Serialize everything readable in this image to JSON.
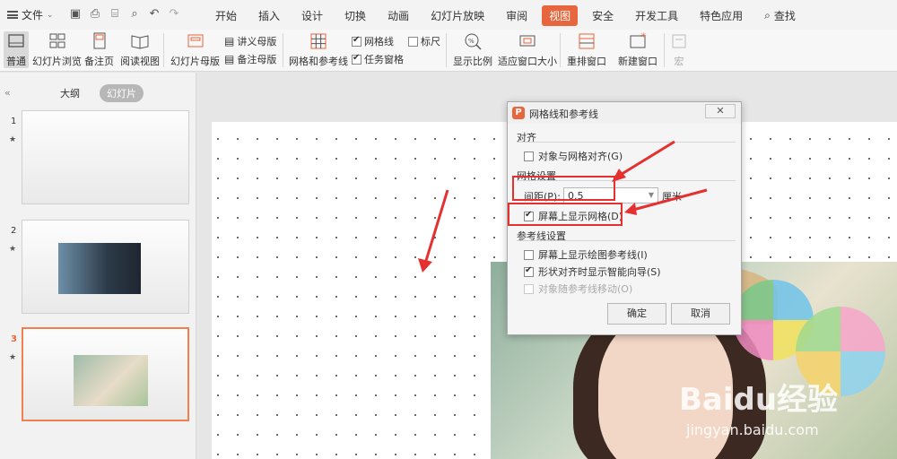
{
  "menu": {
    "file_label": "文件",
    "tabs": [
      "开始",
      "插入",
      "设计",
      "切换",
      "动画",
      "幻灯片放映",
      "审阅",
      "视图",
      "安全",
      "开发工具",
      "特色应用"
    ],
    "active_tab": "视图",
    "search_label": "查找"
  },
  "ribbon": {
    "normal": "普通",
    "slide_browse": "幻灯片浏览",
    "notes_page": "备注页",
    "reading_view": "阅读视图",
    "slide_master": "幻灯片母版",
    "handout_master": "讲义母版",
    "notes_master": "备注母版",
    "grid_guides": "网格和参考线",
    "gridlines": "网格线",
    "ruler": "标尺",
    "task_pane": "任务窗格",
    "zoom": "显示比例",
    "fit_window": "适应窗口大小",
    "arrange_window": "重排窗口",
    "new_window": "新建窗口",
    "macro": "宏"
  },
  "left_panel": {
    "tab_outline": "大纲",
    "tab_slides": "幻灯片",
    "slides": [
      {
        "num": "1",
        "star": "★"
      },
      {
        "num": "2",
        "star": "★"
      },
      {
        "num": "3",
        "star": "★"
      }
    ]
  },
  "dialog": {
    "title": "网格线和参考线",
    "close_label": "✕",
    "section_align": "对齐",
    "snap_to_grid": "对象与网格对齐(G)",
    "section_grid": "网格设置",
    "spacing_label": "间距(P):",
    "spacing_value": "0.5",
    "spacing_unit": "厘米",
    "show_grid": "屏幕上显示网格(D)",
    "section_guides": "参考线设置",
    "show_guides": "屏幕上显示绘图参考线(I)",
    "smart_guides": "形状对齐时显示智能向导(S)",
    "move_with_guides": "对象随参考线移动(O)",
    "ok_label": "确定",
    "cancel_label": "取消"
  },
  "watermark": {
    "brand": "Baidu经验",
    "url": "jingyan.baidu.com"
  },
  "colors": {
    "accent": "#e8663d",
    "annotation_red": "#e53030"
  }
}
